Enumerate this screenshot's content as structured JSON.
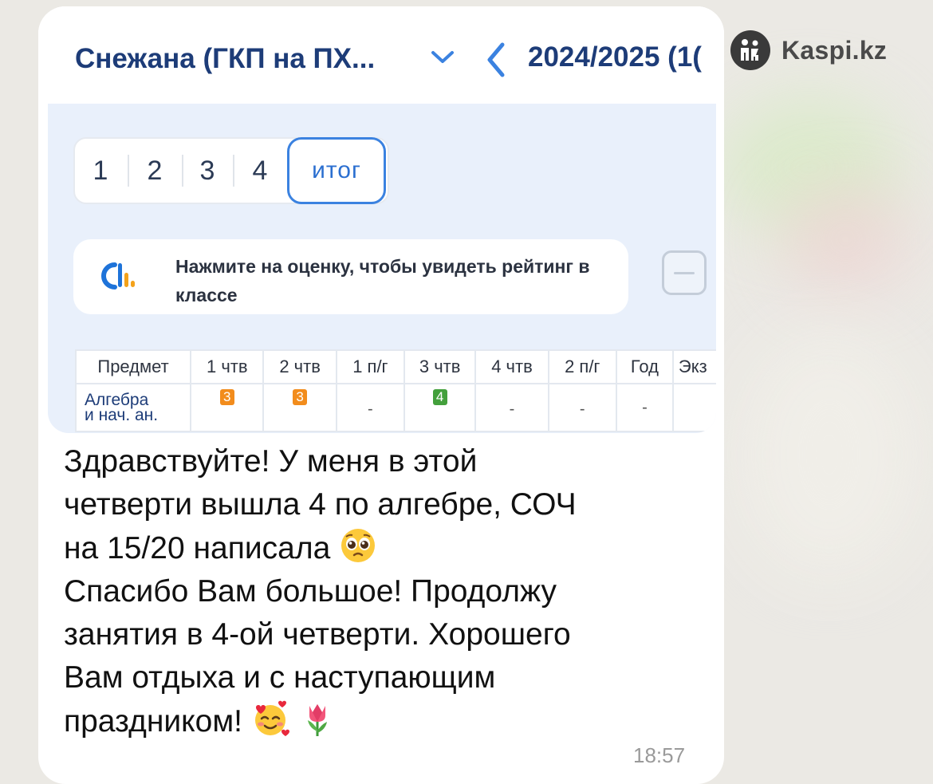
{
  "header": {
    "student_name": "Снежана (ГКП на ПХ...",
    "year": "2024/2025 (1("
  },
  "watermark": {
    "text": "Kaspi.kz"
  },
  "tabs": {
    "items": [
      "1",
      "2",
      "3",
      "4"
    ],
    "active": "итог"
  },
  "hint": {
    "text": "Нажмите на оценку, чтобы увидеть рейтинг в классе"
  },
  "grades_table": {
    "headers": [
      "Предмет",
      "1 чтв",
      "2 чтв",
      "1 п/г",
      "3 чтв",
      "4 чтв",
      "2 п/г",
      "Год",
      "Экз"
    ],
    "row": {
      "subject_line1": "Алгебра",
      "subject_line2": "и нач. ан.",
      "cells": [
        "3",
        "3",
        "-",
        "4",
        "-",
        "-",
        "-",
        ""
      ]
    },
    "grade_colors": {
      "3": "#f28c1c",
      "4": "#43a03c"
    }
  },
  "message": {
    "lines": [
      "Здравствуйте! У меня в этой",
      "четверти вышла 4 по алгебре, СОЧ",
      "на 15/20 написала",
      "Спасибо Вам большое! Продолжу",
      "занятия в 4-ой четверти. Хорошего",
      "Вам отдыха и с наступающим",
      "праздником!"
    ],
    "emojis": [
      "pleading-face",
      "smiling-face-with-hearts",
      "tulip"
    ],
    "time": "18:57"
  },
  "colors": {
    "accent": "#1d3c78",
    "active_tab": "#3b82e0",
    "bubble": "#ffffff"
  }
}
